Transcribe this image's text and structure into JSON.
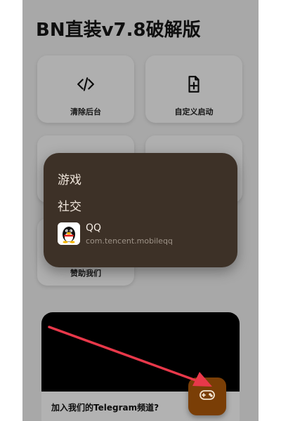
{
  "app": {
    "title": "BN直装v7.8破解版"
  },
  "cards": [
    {
      "label": "清除后台",
      "icon": "code-icon"
    },
    {
      "label": "自定义启动",
      "icon": "add-file-icon"
    },
    {
      "label": "",
      "icon": ""
    },
    {
      "label": "",
      "icon": ""
    },
    {
      "label": "赞助我们",
      "icon": ""
    }
  ],
  "banner": {
    "text": "加入我们的Telegram频道?"
  },
  "popup": {
    "items": [
      "游戏",
      "社交"
    ],
    "app": {
      "name": "QQ",
      "package": "com.tencent.mobileqq",
      "icon": "qq-penguin-icon"
    }
  },
  "fab": {
    "icon": "gamepad-icon",
    "color": "#7a3e06"
  },
  "colors": {
    "popup_bg": "#3d3127",
    "arrow": "#e8384a",
    "screen_bg": "#f1f1f1"
  }
}
